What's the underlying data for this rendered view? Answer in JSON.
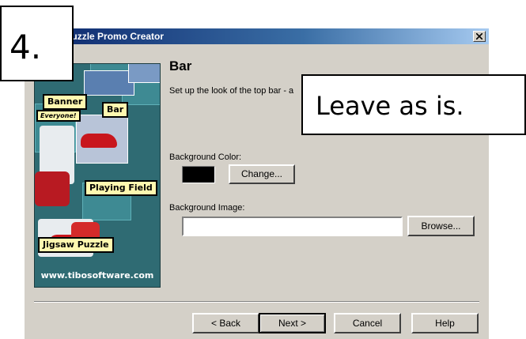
{
  "window": {
    "title": "Jigsaw Puzzle Promo Creator",
    "close_label": "×"
  },
  "promo": {
    "callouts": {
      "banner": "Banner",
      "everyone": "Everyone!",
      "bar": "Bar",
      "playing_field": "Playing Field",
      "jigsaw_puzzle": "Jigsaw Puzzle"
    },
    "url": "www.tibosoftware.com"
  },
  "page": {
    "title": "Bar",
    "description": "Set up the look of the top bar - a"
  },
  "fields": {
    "background_color": {
      "label": "Background Color:",
      "color": "#000000",
      "change_button": "Change..."
    },
    "background_image": {
      "label": "Background Image:",
      "value": "",
      "browse_button": "Browse..."
    }
  },
  "footer": {
    "back": "< Back",
    "next": "Next >",
    "cancel": "Cancel",
    "help": "Help"
  },
  "annotations": {
    "step_number": "4.",
    "note": "Leave as is."
  },
  "colors": {
    "titlebar_start": "#0a246a",
    "titlebar_end": "#a6caf0",
    "dialog_bg": "#d4d0c8",
    "callout_bg": "#fff8b0",
    "promo_bg": "#2f6b73"
  }
}
